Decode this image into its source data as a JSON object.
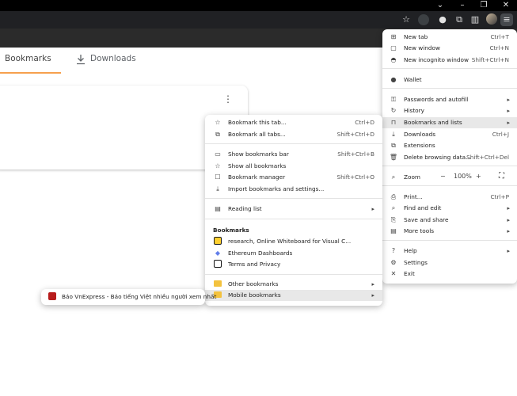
{
  "window": {
    "icons": [
      "chevron-down-icon",
      "minimize-icon",
      "restore-icon",
      "close-icon"
    ]
  },
  "toolbar": {
    "icons": [
      "star-icon",
      "shield-extension-icon",
      "wallet-extension-icon",
      "puzzle-icon",
      "side-panel-icon",
      "avatar",
      "kebab-menu-icon"
    ]
  },
  "page_tabs": {
    "bookmarks": "Bookmarks",
    "downloads": "Downloads",
    "accent_color": "#f6a04d"
  },
  "main_menu": {
    "new_tab": {
      "label": "New tab",
      "shortcut": "Ctrl+T"
    },
    "new_window": {
      "label": "New window",
      "shortcut": "Ctrl+N"
    },
    "new_incognito": {
      "label": "New incognito window",
      "shortcut": "Shift+Ctrl+N"
    },
    "wallet": {
      "label": "Wallet"
    },
    "passwords": {
      "label": "Passwords and autofill"
    },
    "history": {
      "label": "History"
    },
    "bookmarks": {
      "label": "Bookmarks and lists"
    },
    "downloads": {
      "label": "Downloads",
      "shortcut": "Ctrl+J"
    },
    "extensions": {
      "label": "Extensions"
    },
    "delete_data": {
      "label": "Delete browsing data...",
      "shortcut": "Shift+Ctrl+Del"
    },
    "zoom": {
      "label": "Zoom",
      "minus": "−",
      "value": "100%",
      "plus": "+"
    },
    "print": {
      "label": "Print...",
      "shortcut": "Ctrl+P"
    },
    "find_edit": {
      "label": "Find and edit"
    },
    "save_share": {
      "label": "Save and share"
    },
    "more_tools": {
      "label": "More tools"
    },
    "help": {
      "label": "Help"
    },
    "settings": {
      "label": "Settings"
    },
    "exit": {
      "label": "Exit"
    }
  },
  "bookmarks_menu": {
    "bookmark_tab": {
      "label": "Bookmark this tab...",
      "shortcut": "Ctrl+D"
    },
    "bookmark_all": {
      "label": "Bookmark all tabs...",
      "shortcut": "Shift+Ctrl+D"
    },
    "show_bar": {
      "label": "Show bookmarks bar",
      "shortcut": "Shift+Ctrl+B"
    },
    "show_all": {
      "label": "Show all bookmarks"
    },
    "manager": {
      "label": "Bookmark manager",
      "shortcut": "Shift+Ctrl+O"
    },
    "import": {
      "label": "Import bookmarks and settings..."
    },
    "reading_list": {
      "label": "Reading list"
    },
    "section_title": "Bookmarks",
    "items": [
      {
        "label": "research, Online Whiteboard for Visual C...",
        "color": "#1a1a1a"
      },
      {
        "label": "Ethereum Dashboards",
        "color": "#627eea"
      },
      {
        "label": "Terms and Privacy",
        "color": "#111111"
      }
    ],
    "other": {
      "label": "Other bookmarks"
    },
    "mobile": {
      "label": "Mobile bookmarks"
    }
  },
  "mobile_menu": {
    "items": [
      {
        "label": "Báo VnExpress - Báo tiếng Việt nhiều người xem nhất",
        "color": "#b71c1c"
      }
    ]
  }
}
